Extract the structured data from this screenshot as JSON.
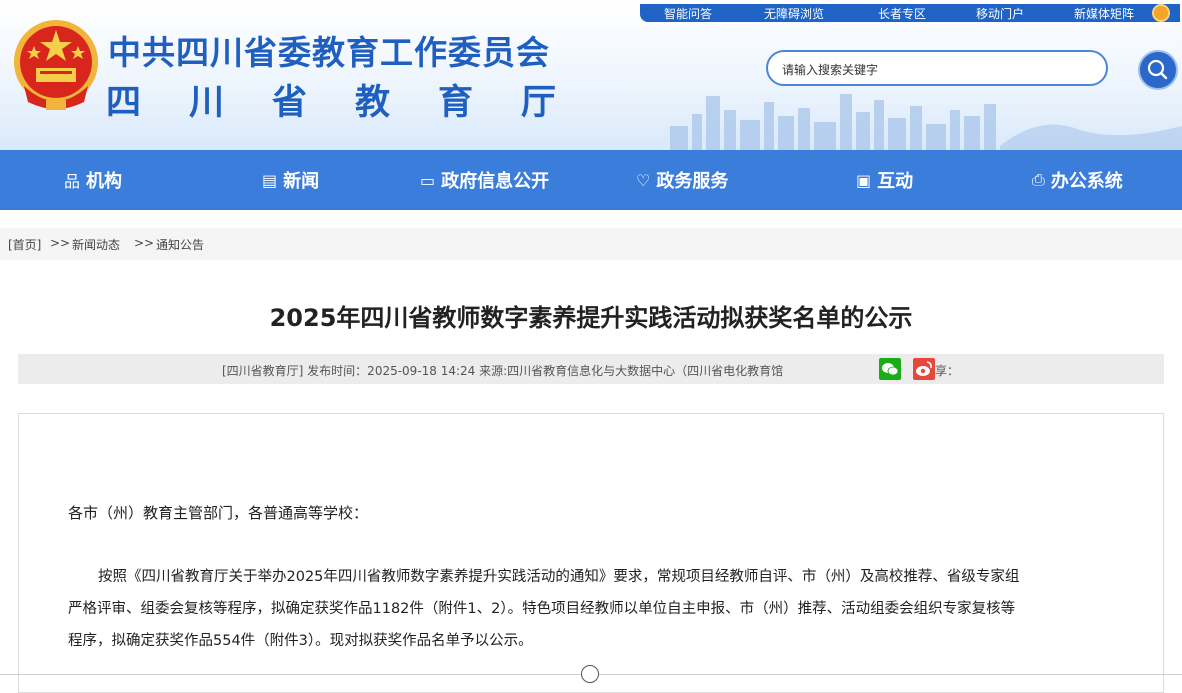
{
  "header": {
    "title_main": "中共四川省委教育工作委员会",
    "title_sub_chars": [
      "四",
      "川",
      "省",
      "教",
      "育",
      "厅"
    ],
    "top_links": [
      "智能问答",
      "无障碍浏览",
      "长者专区",
      "移动门户",
      "新媒体矩阵"
    ],
    "search_placeholder": "请输入搜索关键字",
    "brand_color": "#1f5fbf"
  },
  "nav": {
    "items": [
      {
        "label": "机构",
        "icon": "org-icon"
      },
      {
        "label": "新闻",
        "icon": "news-icon"
      },
      {
        "label": "政府信息公开",
        "icon": "info-icon"
      },
      {
        "label": "政务服务",
        "icon": "service-icon"
      },
      {
        "label": "互动",
        "icon": "chat-icon"
      },
      {
        "label": "办公系统",
        "icon": "printer-icon"
      }
    ],
    "bg_color": "#3b7ddb"
  },
  "breadcrumb": {
    "home": "[首页]",
    "sep": ">>",
    "level1": "新闻动态",
    "level2": "通知公告"
  },
  "article": {
    "title": "2025年四川省教师数字素养提升实践活动拟获奖名单的公示",
    "meta": "[四川省教育厅]   发布时间：2025-09-18 14:24   来源:四川省教育信息化与大数据中心（四川省电化教育馆",
    "share_tail": "享：",
    "salutation": "各市（州）教育主管部门，各普通高等学校：",
    "para_lines": [
      "按照《四川省教育厅关于举办2025年四川省教师数字素养提升实践活动的通知》要求，常规项目经教师自评、市（州）及高校推荐、省级专家组",
      "严格评审、组委会复核等程序，拟确定获奖作品1182件（附件1、2）。特色项目经教师以单位自主申报、市（州）推荐、活动组委会组织专家复核等",
      "程序，拟确定获奖作品554件（附件3）。现对拟获奖作品名单予以公示。"
    ]
  }
}
